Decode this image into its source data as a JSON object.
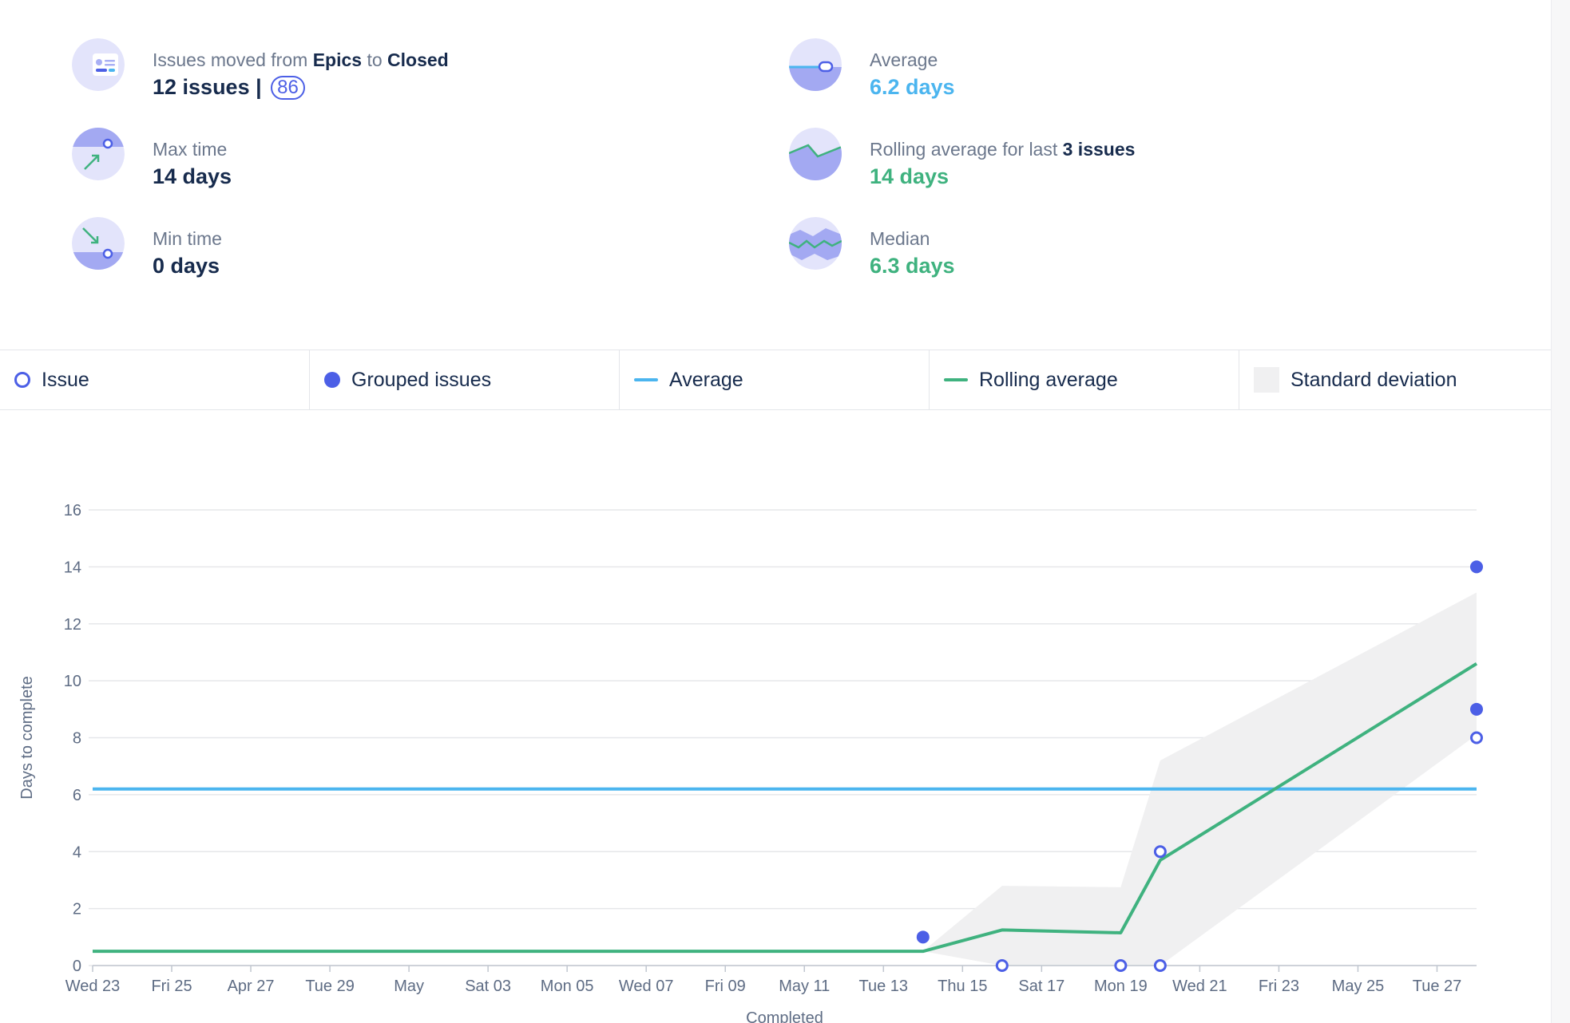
{
  "stats": {
    "moved": {
      "prefix": "Issues moved from ",
      "from": "Epics",
      "mid": " to ",
      "to": "Closed",
      "value": "12 issues |",
      "badge": "86"
    },
    "max": {
      "label": "Max time",
      "value": "14 days"
    },
    "min": {
      "label": "Min time",
      "value": "0 days"
    },
    "average": {
      "label": "Average",
      "value": "6.2 days"
    },
    "rolling": {
      "prefix": "Rolling average for last ",
      "bold": "3 issues",
      "value": "14 days"
    },
    "median": {
      "label": "Median",
      "value": "6.3 days"
    }
  },
  "icons": {
    "moved": "issue-card-icon",
    "max": "max-time-arrow-up-icon",
    "min": "min-time-arrow-down-icon",
    "average": "average-slider-icon",
    "rolling": "rolling-average-wave-icon",
    "median": "median-wave-icon"
  },
  "legend": [
    {
      "key": "issue",
      "label": "Issue"
    },
    {
      "key": "grouped",
      "label": "Grouped issues"
    },
    {
      "key": "average",
      "label": "Average"
    },
    {
      "key": "rolling",
      "label": "Rolling average"
    },
    {
      "key": "stddev",
      "label": "Standard deviation"
    }
  ],
  "colors": {
    "issue": "#4c5fe6",
    "average": "#4bb5ef",
    "rolling": "#3fb27f",
    "stddev": "#f0f0f1",
    "grid": "#e6e7ea",
    "axis_text": "#5e6c84"
  },
  "chart_data": {
    "type": "scatter",
    "xlabel": "Completed",
    "ylabel": "Days to complete",
    "ylim": [
      0,
      16
    ],
    "yticks": [
      0,
      2,
      4,
      6,
      8,
      10,
      12,
      14,
      16
    ],
    "x_range": [
      "2018-04-23",
      "2018-05-28"
    ],
    "x_ticks": [
      {
        "date": "2018-04-23",
        "label": "Wed 23"
      },
      {
        "date": "2018-04-25",
        "label": "Fri 25"
      },
      {
        "date": "2018-04-27",
        "label": "Apr 27"
      },
      {
        "date": "2018-04-29",
        "label": "Tue 29"
      },
      {
        "date": "2018-05-01",
        "label": "May"
      },
      {
        "date": "2018-05-03",
        "label": "Sat 03"
      },
      {
        "date": "2018-05-05",
        "label": "Mon 05"
      },
      {
        "date": "2018-05-07",
        "label": "Wed 07"
      },
      {
        "date": "2018-05-09",
        "label": "Fri 09"
      },
      {
        "date": "2018-05-11",
        "label": "May 11"
      },
      {
        "date": "2018-05-13",
        "label": "Tue 13"
      },
      {
        "date": "2018-05-15",
        "label": "Thu 15"
      },
      {
        "date": "2018-05-17",
        "label": "Sat 17"
      },
      {
        "date": "2018-05-19",
        "label": "Mon 19"
      },
      {
        "date": "2018-05-21",
        "label": "Wed 21"
      },
      {
        "date": "2018-05-23",
        "label": "Fri 23"
      },
      {
        "date": "2018-05-25",
        "label": "May 25"
      },
      {
        "date": "2018-05-27",
        "label": "Tue 27"
      }
    ],
    "issues": [
      {
        "date": "2018-05-16",
        "days": 0
      },
      {
        "date": "2018-05-19",
        "days": 0
      },
      {
        "date": "2018-05-20",
        "days": 0
      },
      {
        "date": "2018-05-20",
        "days": 4
      },
      {
        "date": "2018-05-28",
        "days": 8
      }
    ],
    "grouped_issues": [
      {
        "date": "2018-05-14",
        "days": 1
      },
      {
        "date": "2018-05-28",
        "days": 14
      },
      {
        "date": "2018-05-28",
        "days": 9
      }
    ],
    "average": 6.2,
    "rolling_average": [
      {
        "date": "2018-04-23",
        "days": 0.5
      },
      {
        "date": "2018-05-14",
        "days": 0.5
      },
      {
        "date": "2018-05-16",
        "days": 1.25
      },
      {
        "date": "2018-05-19",
        "days": 1.15
      },
      {
        "date": "2018-05-20",
        "days": 3.7
      },
      {
        "date": "2018-05-28",
        "days": 10.6
      }
    ],
    "std_dev_band": [
      {
        "date": "2018-05-14",
        "low": 0.5,
        "high": 0.5
      },
      {
        "date": "2018-05-16",
        "low": 0,
        "high": 2.8
      },
      {
        "date": "2018-05-19",
        "low": 0,
        "high": 2.75
      },
      {
        "date": "2018-05-20",
        "low": 0,
        "high": 7.2
      },
      {
        "date": "2018-05-28",
        "low": 8.1,
        "high": 13.1
      }
    ]
  }
}
